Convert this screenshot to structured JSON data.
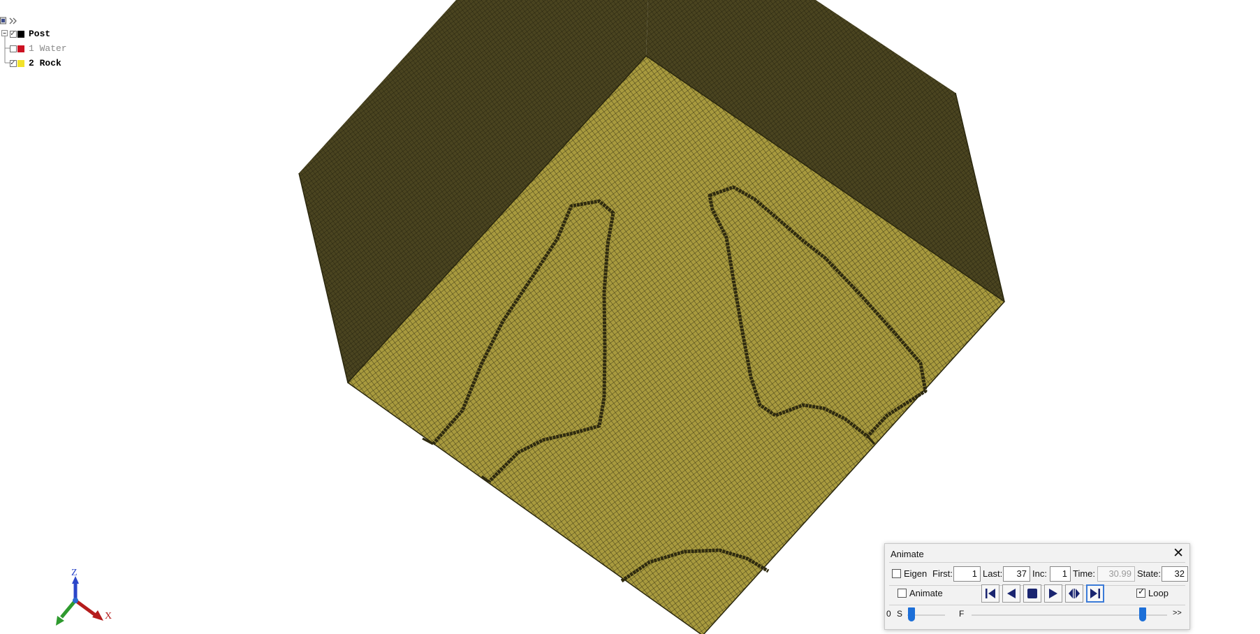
{
  "model_tree": {
    "items": [
      {
        "label": "Post",
        "checked": true,
        "color": "#000000",
        "enabled": true
      },
      {
        "label": "1 Water",
        "checked": false,
        "color": "#cc1122",
        "enabled": false
      },
      {
        "label": "2 Rock",
        "checked": true,
        "color": "#f2e22a",
        "enabled": true
      }
    ]
  },
  "viewport": {
    "model_colors": {
      "top_face": "#a89a3e",
      "side_face": "#4a4420",
      "mesh_line": "#1e1c0a"
    }
  },
  "axis_triad": {
    "z_label": "Z",
    "x_label": "X"
  },
  "animate_dialog": {
    "title": "Animate",
    "close_label": "✕",
    "eigen_label": "Eigen",
    "eigen_checked": false,
    "first_label": "First:",
    "first_value": "1",
    "last_label": "Last:",
    "last_value": "37",
    "inc_label": "Inc:",
    "inc_value": "1",
    "time_label": "Time:",
    "time_value": "30.99",
    "state_label": "State:",
    "state_value": "32",
    "animate_label": "Animate",
    "animate_checked": false,
    "loop_label": "Loop",
    "loop_checked": true,
    "playback_buttons": [
      "first-frame",
      "step-back",
      "stop",
      "play",
      "step-forward",
      "last-frame"
    ],
    "active_button": "last-frame",
    "speed_min_label": "0",
    "s_label": "S",
    "f_label": "F",
    "more_label": ">>",
    "speed_value": 0.0,
    "frame_fraction": 0.86
  }
}
